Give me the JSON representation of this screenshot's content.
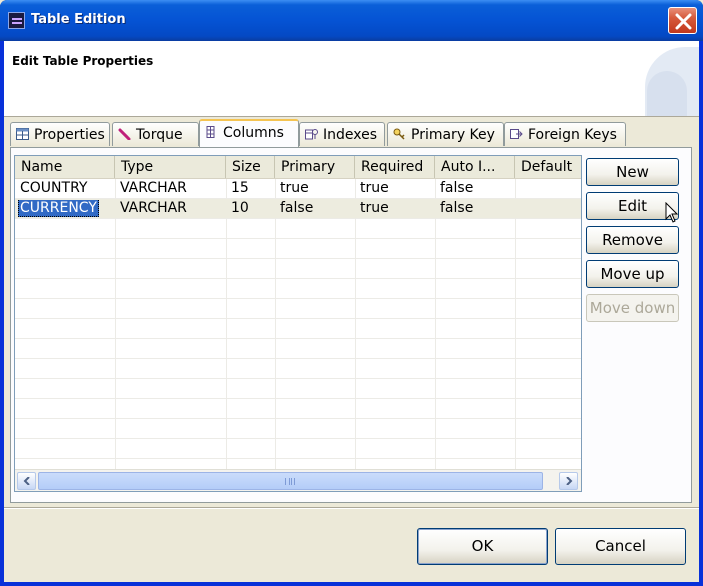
{
  "window": {
    "title": "Table Edition"
  },
  "header": {
    "title": "Edit Table Properties"
  },
  "tabs": [
    {
      "label": "Properties",
      "icon": "table-grid-icon"
    },
    {
      "label": "Torque",
      "icon": "torque-icon"
    },
    {
      "label": "Columns",
      "icon": "columns-icon",
      "active": true
    },
    {
      "label": "Indexes",
      "icon": "indexes-icon"
    },
    {
      "label": "Primary Key",
      "icon": "key-icon"
    },
    {
      "label": "Foreign Keys",
      "icon": "foreign-key-icon"
    }
  ],
  "table": {
    "columns": [
      "Name",
      "Type",
      "Size",
      "Primary",
      "Required",
      "Auto I...",
      "Default"
    ],
    "rows": [
      [
        "COUNTRY",
        "VARCHAR",
        "15",
        "true",
        "true",
        "false",
        ""
      ],
      [
        "CURRENCY",
        "VARCHAR",
        "10",
        "false",
        "true",
        "false",
        ""
      ]
    ],
    "selected_row": 1
  },
  "side_buttons": {
    "new": "New",
    "edit": "Edit",
    "remove": "Remove",
    "move_up": "Move up",
    "move_down": "Move down"
  },
  "dialog_buttons": {
    "ok": "OK",
    "cancel": "Cancel"
  },
  "colors": {
    "title_bar": "#0553d4",
    "selection": "#316ac5",
    "close_button": "#d65a3c"
  }
}
